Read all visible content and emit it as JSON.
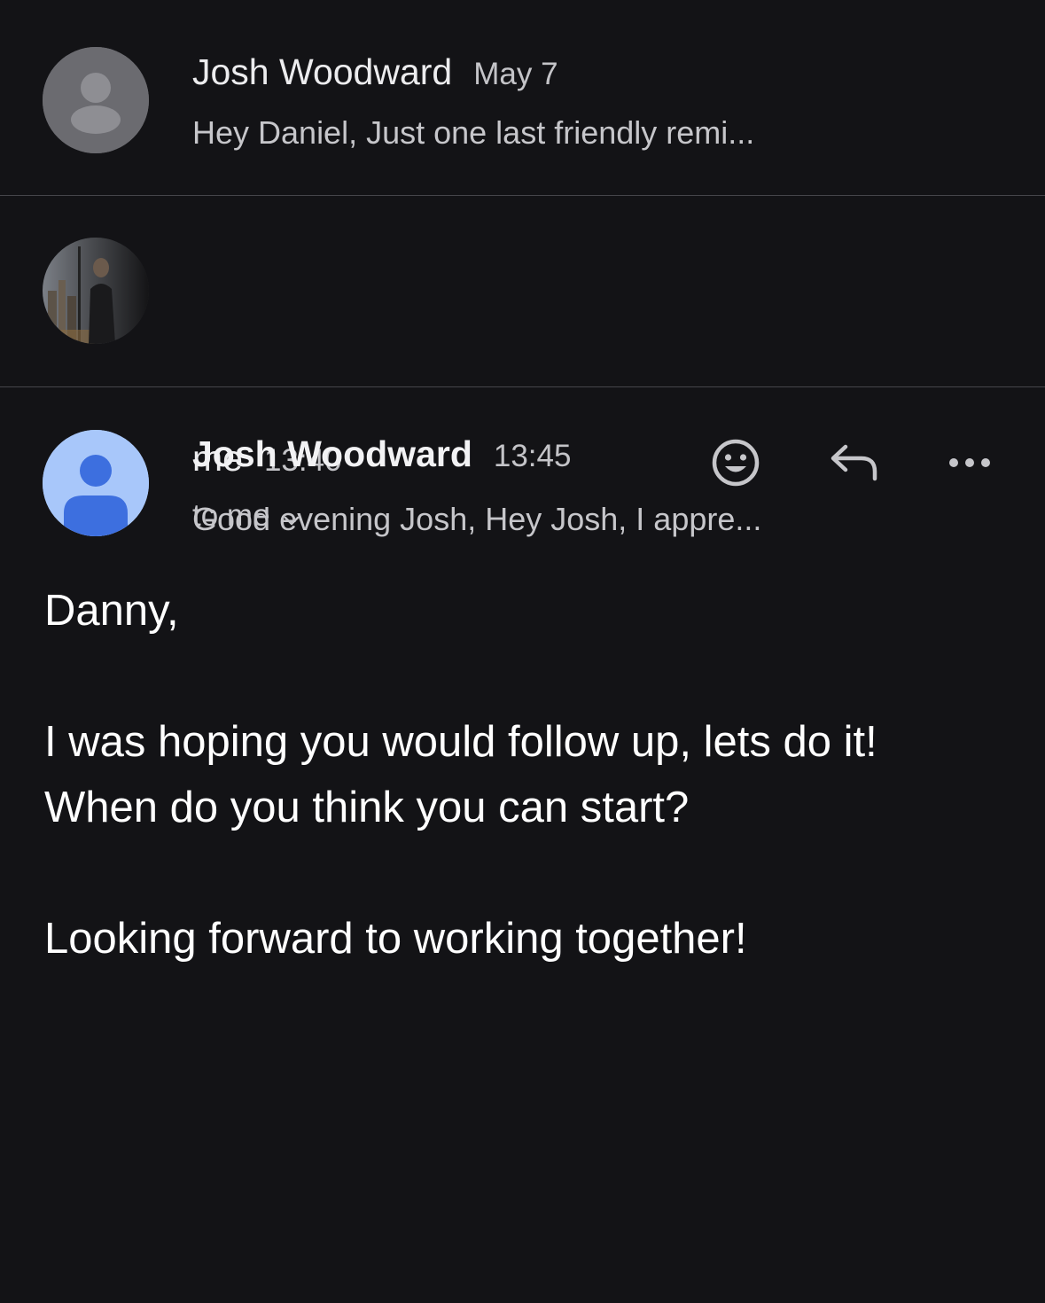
{
  "thread": [
    {
      "sender": "Josh Woodward",
      "time": "May 7",
      "snippet": "Hey Daniel, Just one last friendly remi...",
      "avatar": "default-person-avatar"
    },
    {
      "sender": "me",
      "time": "13:40",
      "snippet": "Good evening Josh, Hey Josh, I appre...",
      "avatar": "user-photo-avatar"
    }
  ],
  "open_message": {
    "sender": "Josh Woodward",
    "time": "13:45",
    "recipient": "to me",
    "avatar": "default-person-avatar-blue",
    "actions": {
      "emoji_icon": "add-reaction-icon",
      "reply_icon": "reply-icon",
      "more_icon": "more-options-icon"
    },
    "body": {
      "greeting": "Danny,",
      "line1": "I was hoping you would follow up, lets do it!",
      "line2": "When do you think you can start?",
      "line3": "Looking forward to working together!"
    }
  },
  "colors": {
    "background": "#131316",
    "divider": "#45454a",
    "avatar_blue": "#a8c7fa",
    "avatar_blue_figure": "#3d6fdf",
    "avatar_gray": "#6b6b70"
  }
}
